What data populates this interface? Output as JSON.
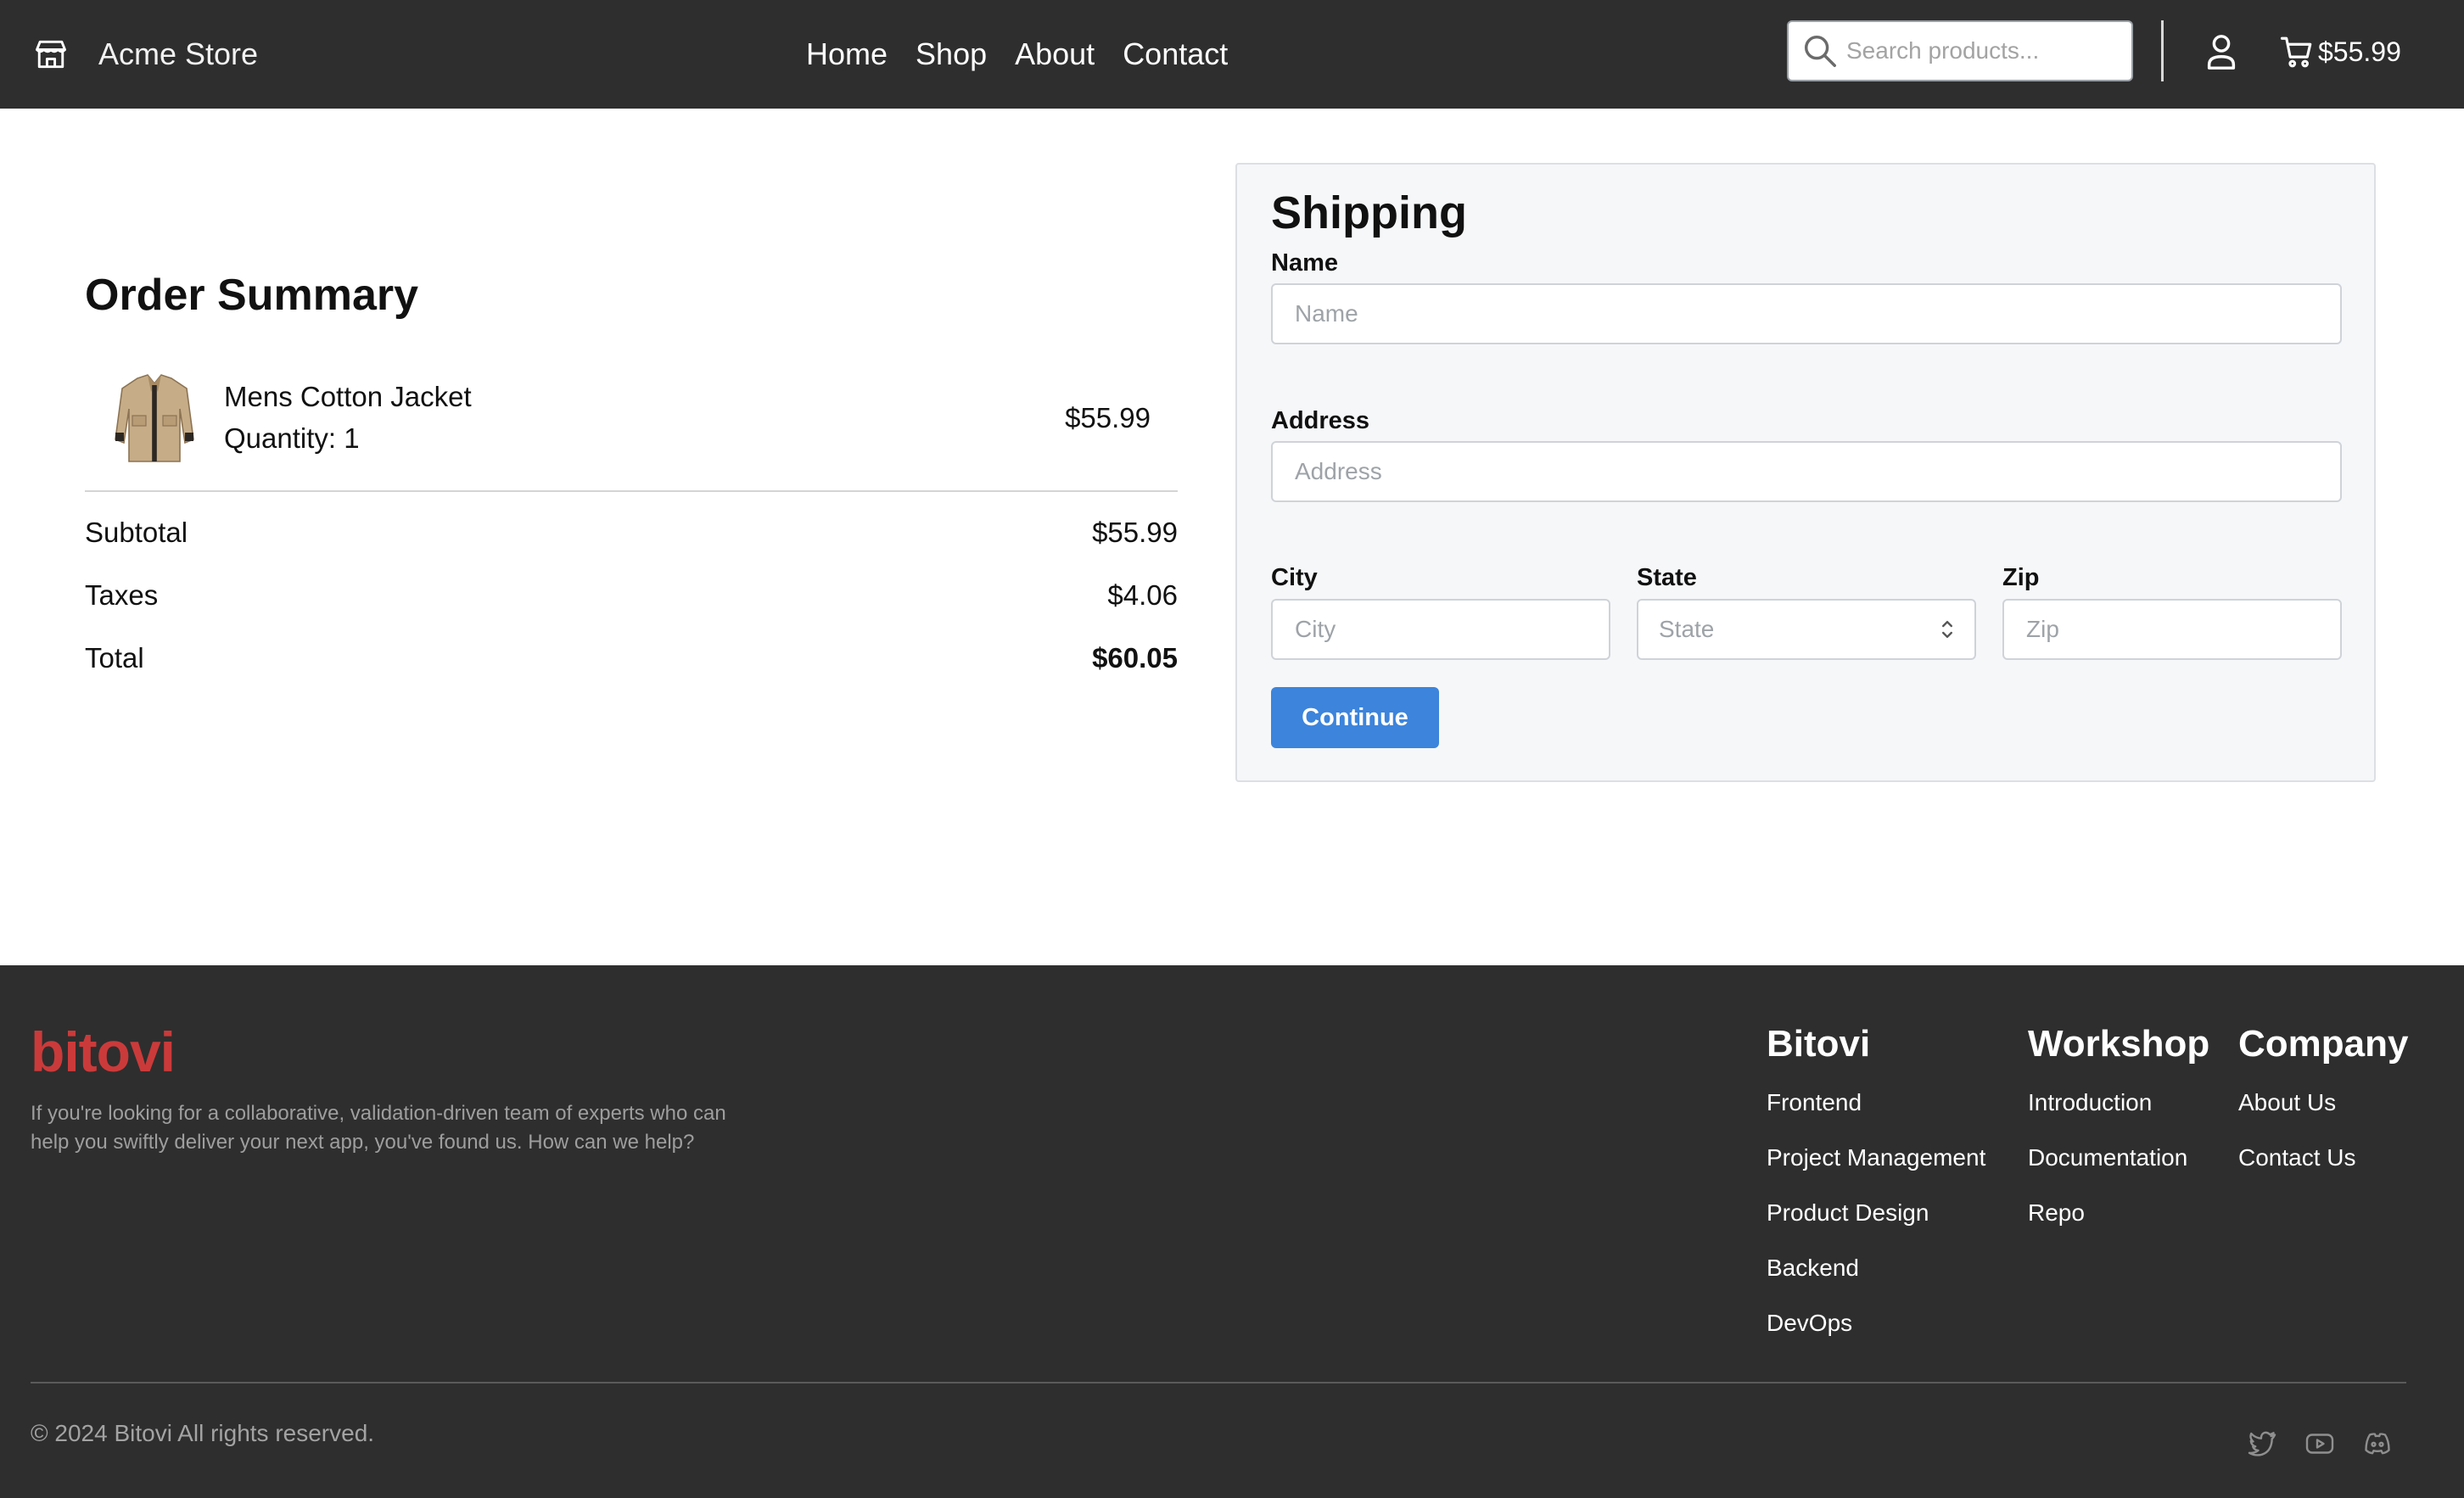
{
  "header": {
    "brand_name": "Acme Store",
    "nav": [
      "Home",
      "Shop",
      "About",
      "Contact"
    ],
    "search_placeholder": "Search products...",
    "cart_total": "$55.99"
  },
  "order_summary": {
    "title": "Order Summary",
    "item": {
      "name": "Mens Cotton Jacket",
      "quantity": "Quantity: 1",
      "price": "$55.99"
    },
    "subtotal_label": "Subtotal",
    "subtotal_value": "$55.99",
    "taxes_label": "Taxes",
    "taxes_value": "$4.06",
    "total_label": "Total",
    "total_value": "$60.05"
  },
  "shipping": {
    "title": "Shipping",
    "name_label": "Name",
    "name_placeholder": "Name",
    "address_label": "Address",
    "address_placeholder": "Address",
    "city_label": "City",
    "city_placeholder": "City",
    "state_label": "State",
    "state_value": "State",
    "zip_label": "Zip",
    "zip_placeholder": "Zip",
    "continue_label": "Continue",
    "button_color": "#3c84dc"
  },
  "footer": {
    "logo": "bitovi",
    "logo_color": "#cb3a3a",
    "tagline": "If you're looking for a collaborative, validation-driven team of experts who can help you swiftly deliver your next app, you've found us. How can we help?",
    "columns": [
      {
        "title": "Bitovi",
        "links": [
          "Frontend",
          "Project Management",
          "Product Design",
          "Backend",
          "DevOps"
        ]
      },
      {
        "title": "Workshop",
        "links": [
          "Introduction",
          "Documentation",
          "Repo"
        ]
      },
      {
        "title": "Company",
        "links": [
          "About Us",
          "Contact Us"
        ]
      }
    ],
    "copyright": "© 2024 Bitovi All rights reserved.",
    "social_icons": [
      "twitter-icon",
      "youtube-icon",
      "discord-icon"
    ]
  }
}
